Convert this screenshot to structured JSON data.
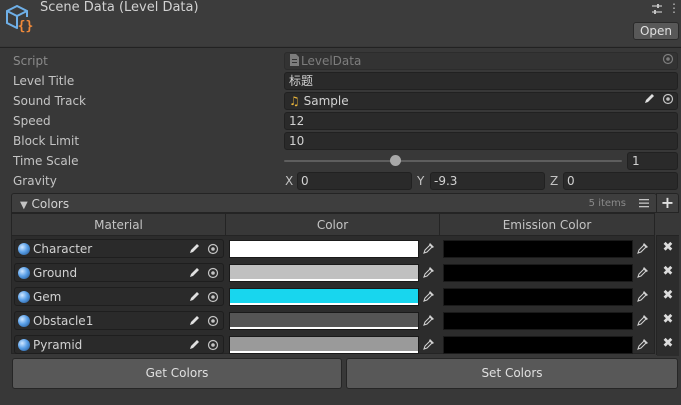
{
  "header": {
    "title": "Scene Data (Level Data)",
    "icon": "script-object-icon",
    "open_label": "Open"
  },
  "fields": {
    "script": {
      "label": "Script",
      "value": "LevelData"
    },
    "level_title": {
      "label": "Level Title",
      "value": "标题"
    },
    "sound_track": {
      "label": "Sound Track",
      "value": "Sample"
    },
    "speed": {
      "label": "Speed",
      "value": "12"
    },
    "block_limit": {
      "label": "Block Limit",
      "value": "10"
    },
    "time_scale": {
      "label": "Time Scale",
      "value": "1",
      "slider_fraction": 0.33
    },
    "gravity": {
      "label": "Gravity",
      "x_label": "X",
      "x": "0",
      "y_label": "Y",
      "y": "-9.3",
      "z_label": "Z",
      "z": "0"
    }
  },
  "colors": {
    "label": "Colors",
    "count": "5 items",
    "columns": [
      "Material",
      "Color",
      "Emission Color"
    ],
    "rows": [
      {
        "material": "Character",
        "color": "#ffffff",
        "emission": "#000000"
      },
      {
        "material": "Ground",
        "color": "#c0c0c0",
        "emission": "#000000"
      },
      {
        "material": "Gem",
        "color": "#18d6ee",
        "emission": "#000000"
      },
      {
        "material": "Obstacle1",
        "color": "#555555",
        "emission": "#000000"
      },
      {
        "material": "Pyramid",
        "color": "#9a9a9a",
        "emission": "#000000"
      }
    ]
  },
  "buttons": {
    "get_colors": "Get Colors",
    "set_colors": "Set Colors"
  }
}
